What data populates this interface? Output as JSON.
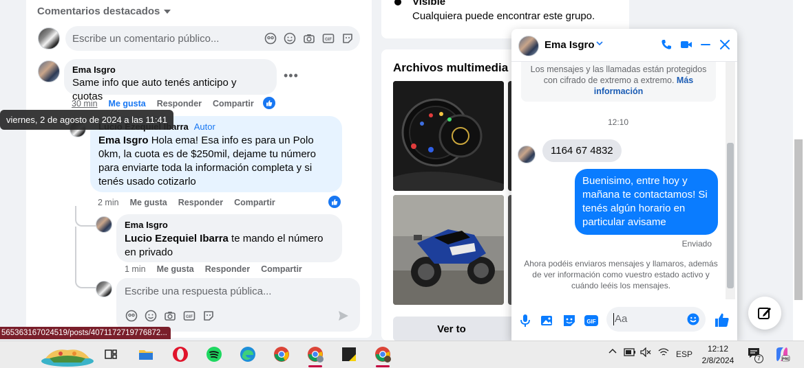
{
  "comments": {
    "sort_label": "Comentarios destacados",
    "composer_placeholder": "Escribe un comentario público...",
    "items": [
      {
        "author": "Ema Isgro",
        "text": "Same info que auto tenés anticipo y cuotas",
        "time": "30 min",
        "like": "Me gusta",
        "reply": "Responder",
        "share": "Compartir"
      },
      {
        "author": "Lucio Ezequiel Ibarra",
        "author_tag": "Autor",
        "mention": "Ema Isgro",
        "text": "Hola ema! Esa info es para un Polo 0km, la cuota es de $250mil, dejame tu número para enviarte toda la información completa y si tenés usado cotizarlo",
        "time": "2 min",
        "like": "Me gusta",
        "reply": "Responder",
        "share": "Compartir"
      },
      {
        "author": "Ema Isgro",
        "mention": "Lucio Ezequiel Ibarra",
        "text": "te mando el número en privado",
        "time": "1 min",
        "like": "Me gusta",
        "reply": "Responder",
        "share": "Compartir"
      }
    ],
    "reply_placeholder": "Escribe una respuesta pública..."
  },
  "tooltip": "viernes, 2 de agosto de 2024 a las 11:41",
  "status_url": "565363167024519/posts/4071172719776872...",
  "group_info": {
    "visible_title": "Visible",
    "visible_desc": "Cualquiera puede encontrar este grupo."
  },
  "media": {
    "title": "Archivos multimedia re",
    "see_all": "Ver to"
  },
  "chat": {
    "contact_name": "Ema Isgro",
    "encryption_notice": "Los mensajes y las llamadas están protegidos con cifrado de extremo a extremo.",
    "encryption_link": "Más información",
    "timestamp": "12:10",
    "incoming_message": "1164 67 4832",
    "outgoing_message": "Buenisimo, entre hoy y mañana te contactamos! Si tenés algún horario en particular avisame",
    "sent_status": "Enviado",
    "info_notice": "Ahora podéis enviaros mensajes y llamaros, además de ver información como vuestro estado activo y cuándo leéis los mensajes.",
    "input_placeholder": "Aa",
    "accent_color": "#0a7cff"
  },
  "taskbar": {
    "lang": "ESP",
    "time": "12:12",
    "date": "2/8/2024",
    "notification_count": "7"
  }
}
